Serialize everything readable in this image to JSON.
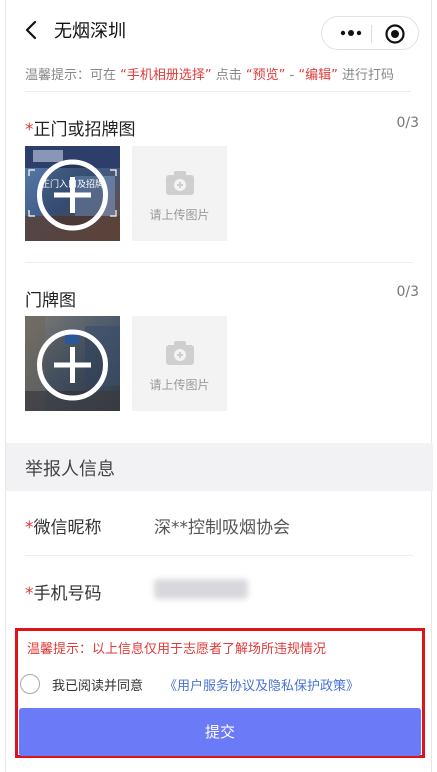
{
  "nav": {
    "title": "无烟深圳",
    "back_icon": "chevron-left-icon",
    "more_icon": "more-dots-icon",
    "close_icon": "target-icon"
  },
  "tip": {
    "prefix": "温馨提示：可在 ",
    "highlight1": "“手机相册选择”",
    "mid1": " 点击 ",
    "highlight2": "“预览”",
    "mid2": " - ",
    "highlight3": "“编辑”",
    "suffix": " 进行打码"
  },
  "front_photo": {
    "required_mark": "*",
    "title": "正门或招牌图",
    "counter": "0/3",
    "thumb_text": "正门入口及招牌",
    "upload_label": "请上传图片",
    "upload_icon": "camera-icon"
  },
  "door_photo": {
    "title": "门牌图",
    "counter": "0/3",
    "upload_label": "请上传图片",
    "upload_icon": "camera-icon"
  },
  "reporter": {
    "section_title": "举报人信息",
    "wechat_required": "*",
    "wechat_label": "微信昵称",
    "wechat_value": "深**控制吸烟协会",
    "phone_required": "*",
    "phone_label": "手机号码"
  },
  "footer": {
    "notice": "温馨提示：以上信息仅用于志愿者了解场所违规情况",
    "agree_text": "我已阅读并同意",
    "agree_link": "《用户服务协议及隐私保护政策》",
    "submit_label": "提交"
  },
  "colors": {
    "accent_red": "#e03a3a",
    "link_blue": "#4a72d8",
    "submit_bg": "#6b7bf7",
    "highlight_border": "#e0131b"
  }
}
